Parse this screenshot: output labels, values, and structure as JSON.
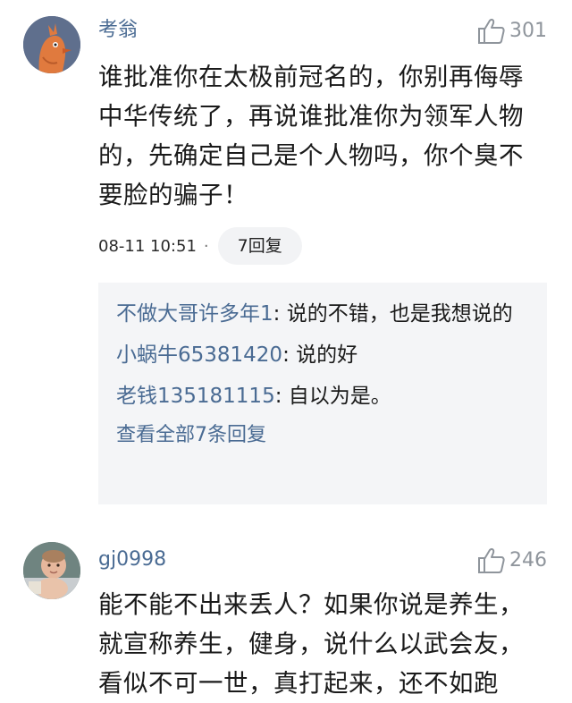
{
  "comments": [
    {
      "username": "考翁",
      "likes": "301",
      "text": "谁批准你在太极前冠名的，你别再侮辱中华传统了，再说谁批准你为领军人物的，先确定自己是个人物吗，你个臭不要脸的骗子！",
      "time": "08-11 10:51",
      "separator": "·",
      "reply_count_label": "7回复",
      "replies": [
        {
          "name": "不做大哥许多年1",
          "text": ": 说的不错，也是我想说的"
        },
        {
          "name": "小蜗牛65381420",
          "text": ": 说的好"
        },
        {
          "name": "老钱135181115",
          "text": ": 自以为是。"
        }
      ],
      "see_all_label": "查看全部7条回复"
    },
    {
      "username": "gj0998",
      "likes": "246",
      "text": "能不能不出来丢人？如果你说是养生，就宣称养生，健身，说什么以武会友，看似不可一世，真打起来，还不如跑"
    }
  ],
  "icons": {
    "like": "thumbs-up-icon",
    "avatar1": "cartoon-bird-avatar",
    "avatar2": "baby-photo-avatar"
  },
  "colors": {
    "username": "#4a6b93",
    "like_count": "#8f959c",
    "reply_bg": "#f4f5f7",
    "avatar1_bg": "#5f6f8d",
    "avatar1_fg": "#e07a3e"
  }
}
